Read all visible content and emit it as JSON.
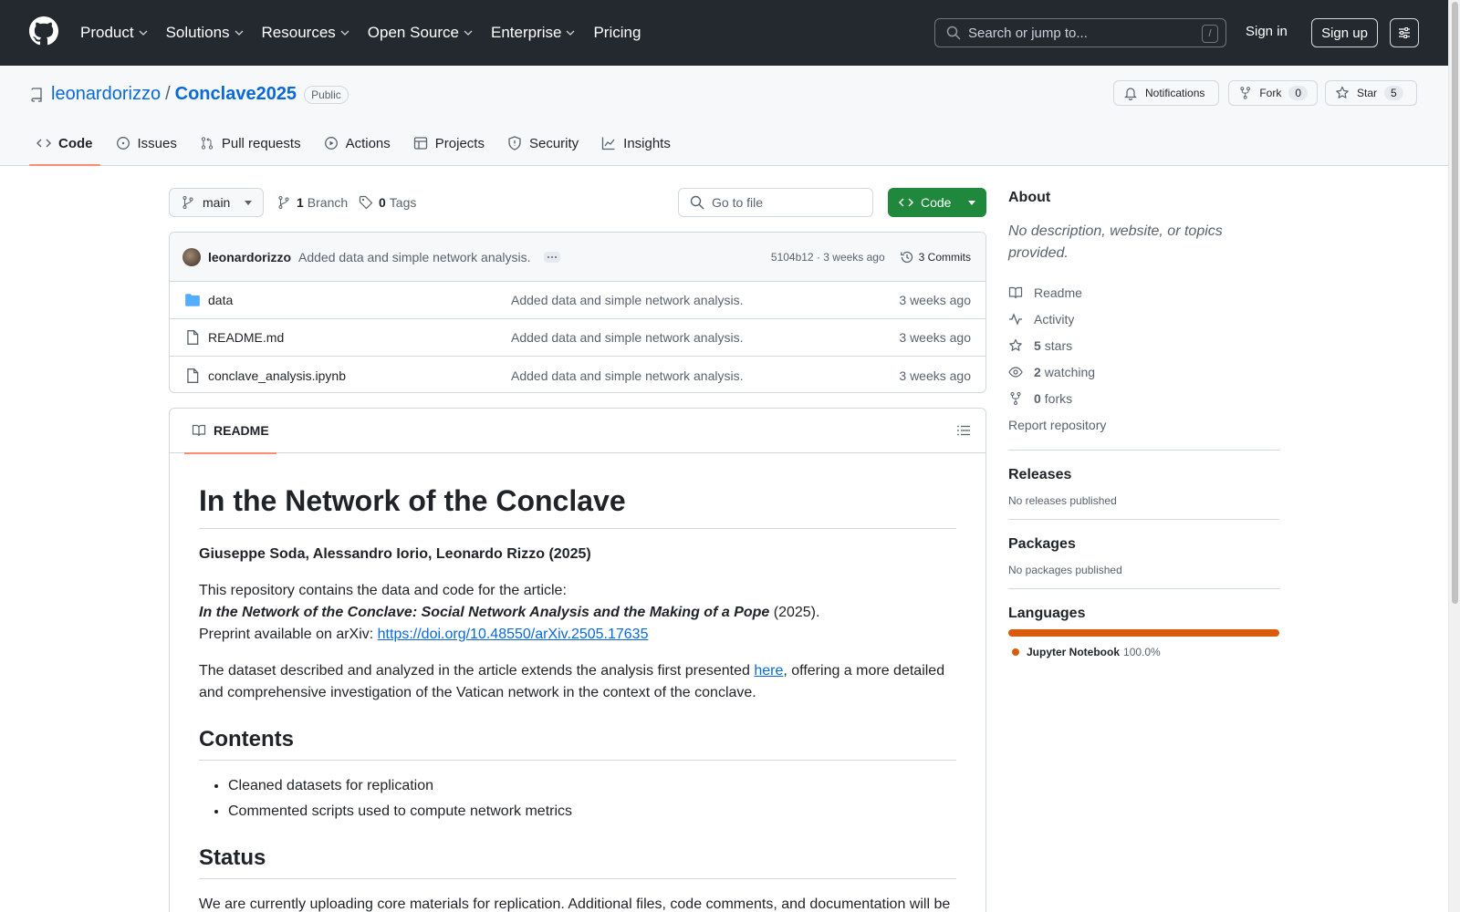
{
  "header": {
    "nav": [
      {
        "label": "Product",
        "has_menu": true
      },
      {
        "label": "Solutions",
        "has_menu": true
      },
      {
        "label": "Resources",
        "has_menu": true
      },
      {
        "label": "Open Source",
        "has_menu": true
      },
      {
        "label": "Enterprise",
        "has_menu": true
      },
      {
        "label": "Pricing",
        "has_menu": false
      }
    ],
    "search_placeholder": "Search or jump to...",
    "search_shortcut": "/",
    "signin_label": "Sign in",
    "signup_label": "Sign up"
  },
  "repo": {
    "owner": "leonardorizzo",
    "separator": "/",
    "name": "Conclave2025",
    "visibility": "Public",
    "notifications_label": "Notifications",
    "fork_label": "Fork",
    "fork_count": "0",
    "star_label": "Star",
    "star_count": "5",
    "tabs": [
      {
        "label": "Code",
        "icon": "code-icon",
        "active": true
      },
      {
        "label": "Issues",
        "icon": "issue-icon",
        "active": false
      },
      {
        "label": "Pull requests",
        "icon": "pull-request-icon",
        "active": false
      },
      {
        "label": "Actions",
        "icon": "play-icon",
        "active": false
      },
      {
        "label": "Projects",
        "icon": "table-icon",
        "active": false
      },
      {
        "label": "Security",
        "icon": "shield-icon",
        "active": false
      },
      {
        "label": "Insights",
        "icon": "graph-icon",
        "active": false
      }
    ]
  },
  "toolbar": {
    "branch": "main",
    "branch_count": "1",
    "branch_label": "Branch",
    "tag_count": "0",
    "tag_label": "Tags",
    "goto_placeholder": "Go to file",
    "code_button": "Code"
  },
  "commit": {
    "author": "leonardorizzo",
    "message": "Added data and simple network analysis.",
    "hash_time": "5104b12 · 3 weeks ago",
    "commits_label": "3 Commits"
  },
  "files": [
    {
      "name": "data",
      "type": "folder",
      "message": "Added data and simple network analysis.",
      "time": "3 weeks ago"
    },
    {
      "name": "README.md",
      "type": "file",
      "message": "Added data and simple network analysis.",
      "time": "3 weeks ago"
    },
    {
      "name": "conclave_analysis.ipynb",
      "type": "file",
      "message": "Added data and simple network analysis.",
      "time": "3 weeks ago"
    }
  ],
  "readme": {
    "tab_label": "README",
    "title": "In the Network of the Conclave",
    "authors": "Giuseppe Soda, Alessandro Iorio, Leonardo Rizzo (2025)",
    "intro_line1": "This repository contains the data and code for the article:",
    "article_title": "In the Network of the Conclave: Social Network Analysis and the Making of a Pope",
    "article_year": " (2025).",
    "preprint_prefix": "Preprint available on arXiv: ",
    "preprint_link": "https://doi.org/10.48550/arXiv.2505.17635",
    "dataset_pre": "The dataset described and analyzed in the article extends the analysis first presented ",
    "dataset_link": "here",
    "dataset_post": ", offering a more detailed and comprehensive investigation of the Vatican network in the context of the conclave.",
    "contents_heading": "Contents",
    "contents_items": [
      "Cleaned datasets for replication",
      "Commented scripts used to compute network metrics"
    ],
    "status_heading": "Status",
    "status_text": "We are currently uploading core materials for replication. Additional files, code comments, and documentation will be"
  },
  "sidebar": {
    "about_title": "About",
    "about_desc": "No description, website, or topics provided.",
    "readme_link": "Readme",
    "activity_link": "Activity",
    "stars_count": "5",
    "stars_label": "stars",
    "watching_count": "2",
    "watching_label": "watching",
    "forks_count": "0",
    "forks_label": "forks",
    "report_link": "Report repository",
    "releases_title": "Releases",
    "releases_text": "No releases published",
    "packages_title": "Packages",
    "packages_text": "No packages published",
    "languages_title": "Languages",
    "language_name": "Jupyter Notebook",
    "language_pct": "100.0%",
    "language_color": "#da5b0b"
  }
}
